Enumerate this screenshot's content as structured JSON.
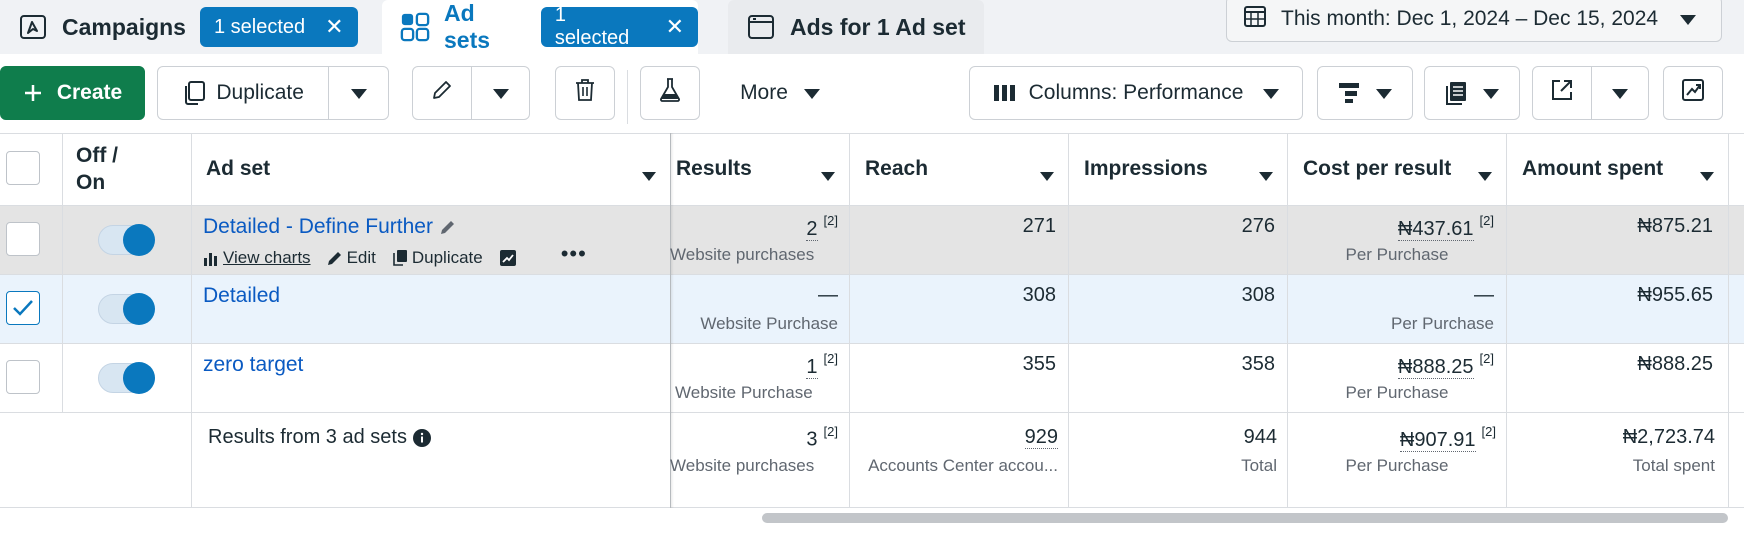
{
  "tabs": {
    "campaigns": {
      "label": "Campaigns",
      "selection": "1 selected"
    },
    "adsets": {
      "label": "Ad sets",
      "selection": "1 selected"
    },
    "ads": {
      "label": "Ads for 1 Ad set"
    }
  },
  "date_range": {
    "label": "This month: Dec 1, 2024 – Dec 15, 2024"
  },
  "toolbar": {
    "create_label": "Create",
    "duplicate_label": "Duplicate",
    "more_label": "More",
    "columns_label": "Columns: Performance"
  },
  "table": {
    "headers": {
      "toggle": "Off / On",
      "adset": "Ad set",
      "results": "Results",
      "reach": "Reach",
      "impressions": "Impressions",
      "cost": "Cost per result",
      "spent": "Amount spent"
    },
    "rows": [
      {
        "name": "Detailed - Define Further",
        "results": "2",
        "results_note": "[2]",
        "results_sub": "Website purchases",
        "reach": "271",
        "impressions": "276",
        "cost": "₦437.61",
        "cost_note": "[2]",
        "cost_sub": "Per Purchase",
        "spent": "₦875.21",
        "actions": {
          "view_charts": "View charts",
          "edit": "Edit",
          "duplicate": "Duplicate"
        }
      },
      {
        "name": "Detailed",
        "results": "—",
        "results_sub": "Website Purchase",
        "reach": "308",
        "impressions": "308",
        "cost": "—",
        "cost_sub": "Per Purchase",
        "spent": "₦955.65"
      },
      {
        "name": "zero target",
        "results": "1",
        "results_note": "[2]",
        "results_sub": "Website Purchase",
        "reach": "355",
        "impressions": "358",
        "cost": "₦888.25",
        "cost_note": "[2]",
        "cost_sub": "Per Purchase",
        "spent": "₦888.25"
      }
    ],
    "summary": {
      "label": "Results from 3 ad sets",
      "results": "3",
      "results_note": "[2]",
      "results_sub": "Website purchases",
      "reach": "929",
      "reach_sub": "Accounts Center accou...",
      "impressions": "944",
      "impressions_sub": "Total",
      "cost": "₦907.91",
      "cost_note": "[2]",
      "cost_sub": "Per Purchase",
      "spent": "₦2,723.74",
      "spent_sub": "Total spent"
    }
  },
  "colors": {
    "accent": "#0a78be",
    "create_green": "#0f7d4c",
    "link": "#0a5ac2",
    "hover_row": "#e4e4e4",
    "selected_row": "#eaf3fc"
  }
}
